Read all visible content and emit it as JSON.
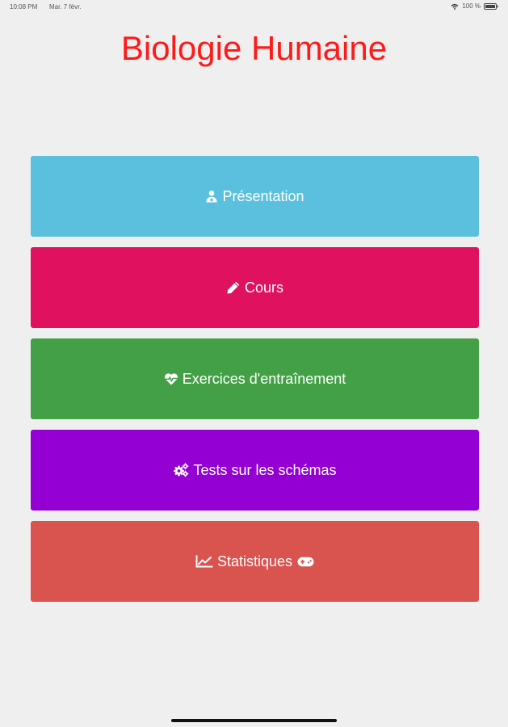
{
  "status_bar": {
    "time": "10:08 PM",
    "date": "Mar. 7 févr.",
    "battery": "100 %"
  },
  "app": {
    "title": "Biologie Humaine",
    "title_color": "#ff1a1a"
  },
  "menu": [
    {
      "label": "Présentation",
      "icon": "user-doctor-icon",
      "color": "#5bc0de"
    },
    {
      "label": "Cours",
      "icon": "pencil-icon",
      "color": "#e0115f"
    },
    {
      "label": "Exercices d'entraînement",
      "icon": "heartbeat-icon",
      "color": "#43a047"
    },
    {
      "label": "Tests sur les schémas",
      "icon": "cogs-icon",
      "color": "#9400d3"
    },
    {
      "label": "Statistiques",
      "icon": "line-chart-icon",
      "trailing_icon": "gamepad-icon",
      "color": "#d9534f"
    }
  ]
}
